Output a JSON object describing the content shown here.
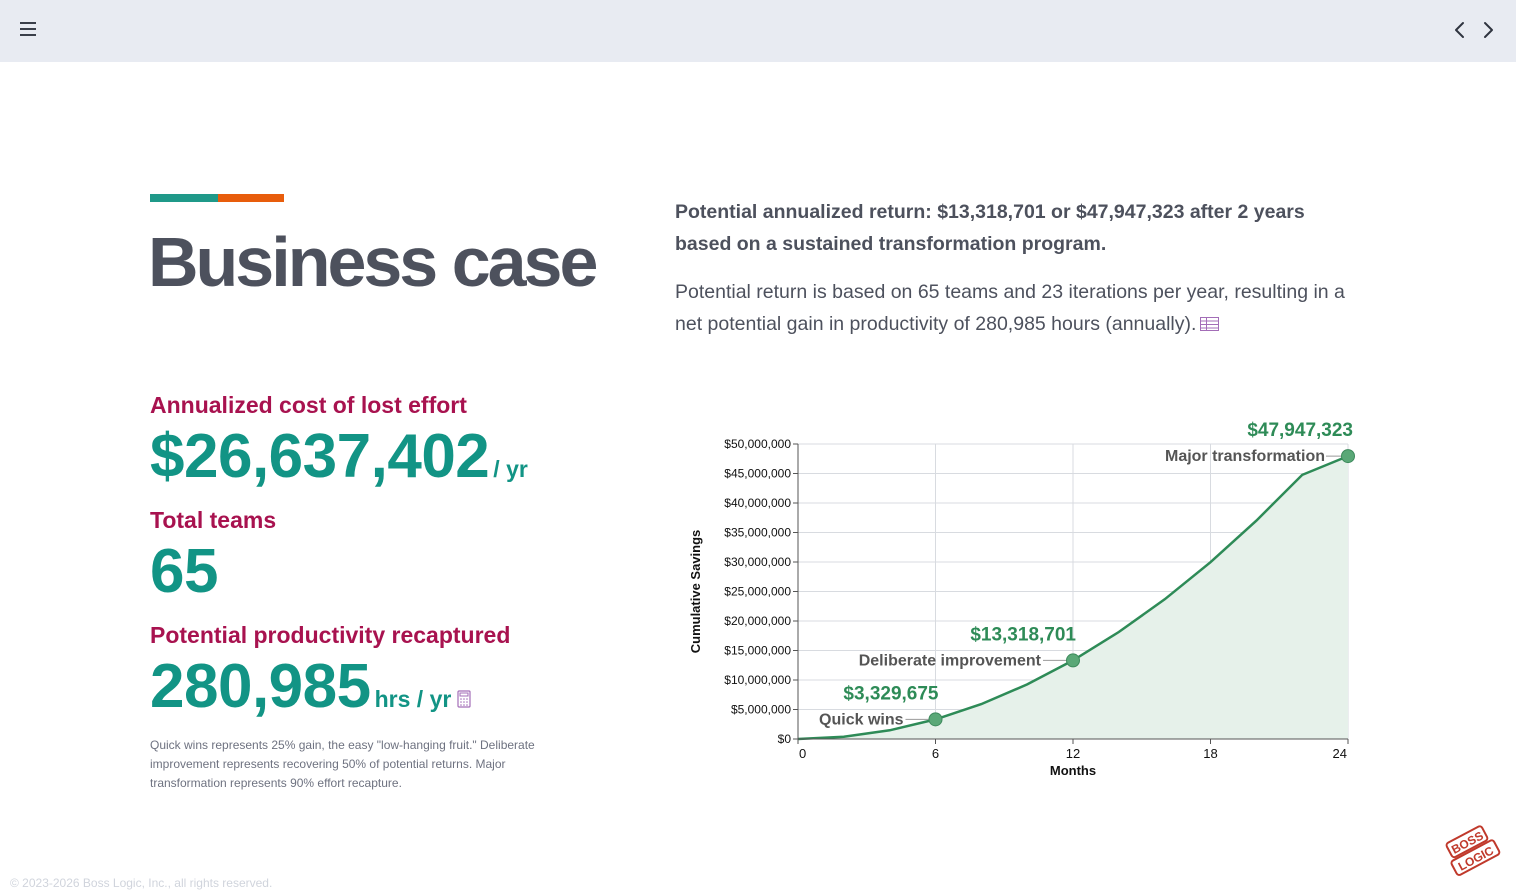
{
  "header": {
    "menu_icon": "hamburger-menu-icon",
    "prev_icon": "chevron-left-icon",
    "next_icon": "chevron-right-icon"
  },
  "page": {
    "title": "Business case",
    "accent_colors": [
      "#1f9989",
      "#e85d0c"
    ]
  },
  "summary": {
    "headline": "Potential annualized return: $13,318,701 or $47,947,323 after 2 years based on a sustained transformation program.",
    "detail": "Potential return is based on 65 teams and 23 iterations per year, resulting in a net potential gain in productivity of 280,985 hours (annually).",
    "detail_icon": "table-icon"
  },
  "metrics": [
    {
      "label": "Annualized cost of lost effort",
      "value": "$26,637,402",
      "unit": "/ yr"
    },
    {
      "label": "Total teams",
      "value": "65",
      "unit": ""
    },
    {
      "label": "Potential productivity recaptured",
      "value": "280,985",
      "unit": "hrs / yr",
      "icon": "calculator-icon"
    }
  ],
  "footnote": "Quick wins represents 25% gain, the easy \"low-hanging fruit.\" Deliberate improvement represents recovering 50% of potential returns. Major transformation represents 90% effort recapture.",
  "colors": {
    "label": "#a8124f",
    "value": "#129485",
    "line": "#2e8b57",
    "area": "#e6f1ea"
  },
  "chart_data": {
    "type": "area",
    "xlabel": "Months",
    "ylabel": "Cumulative Savings",
    "xlim": [
      0,
      24
    ],
    "ylim": [
      0,
      50000000
    ],
    "xticks": [
      0,
      6,
      12,
      18,
      24
    ],
    "yticks": [
      0,
      5000000,
      10000000,
      15000000,
      20000000,
      25000000,
      30000000,
      35000000,
      40000000,
      45000000,
      50000000
    ],
    "ytick_labels": [
      "$0",
      "$5,000,000",
      "$10,000,000",
      "$15,000,000",
      "$20,000,000",
      "$25,000,000",
      "$30,000,000",
      "$35,000,000",
      "$40,000,000",
      "$45,000,000",
      "$50,000,000"
    ],
    "grid": true,
    "series": [
      {
        "x": [
          0,
          2,
          4,
          6,
          8,
          10,
          12,
          14,
          16,
          18,
          20,
          22,
          24
        ],
        "values": [
          0,
          369964,
          1479855,
          3329675,
          5919422,
          9249098,
          13318701,
          18128232,
          23677692,
          29967079,
          36996394,
          44765637,
          47947323
        ]
      }
    ],
    "milestones": [
      {
        "x": 6,
        "y": 3329675,
        "value_label": "$3,329,675",
        "name": "Quick wins"
      },
      {
        "x": 12,
        "y": 13318701,
        "value_label": "$13,318,701",
        "name": "Deliberate improvement"
      },
      {
        "x": 24,
        "y": 47947323,
        "value_label": "$47,947,323",
        "name": "Major transformation"
      }
    ]
  },
  "footer": {
    "copyright": "© 2023-2026 Boss Logic, Inc., all rights reserved.",
    "logo_text": "BOSS LOGIC",
    "logo_icon": "boss-logic-logo"
  }
}
